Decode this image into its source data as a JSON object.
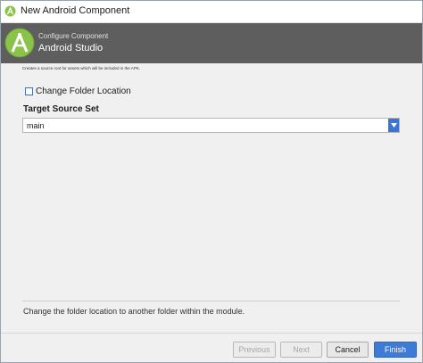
{
  "window": {
    "title": "New Android Component"
  },
  "banner": {
    "subtitle": "Configure Component",
    "title": "Android Studio"
  },
  "form": {
    "description": "Creates a source root for assets which will be included in the APK.",
    "change_folder": {
      "label": "Change Folder Location",
      "checked": false
    },
    "target_source_set": {
      "label": "Target Source Set",
      "value": "main"
    }
  },
  "help": {
    "text": "Change the folder location to another folder within the module."
  },
  "buttons": {
    "previous": "Previous",
    "next": "Next",
    "cancel": "Cancel",
    "finish": "Finish"
  },
  "colors": {
    "banner": "#5e5e5e",
    "accent": "#3d7bd6",
    "android_green": "#8bc34a"
  }
}
